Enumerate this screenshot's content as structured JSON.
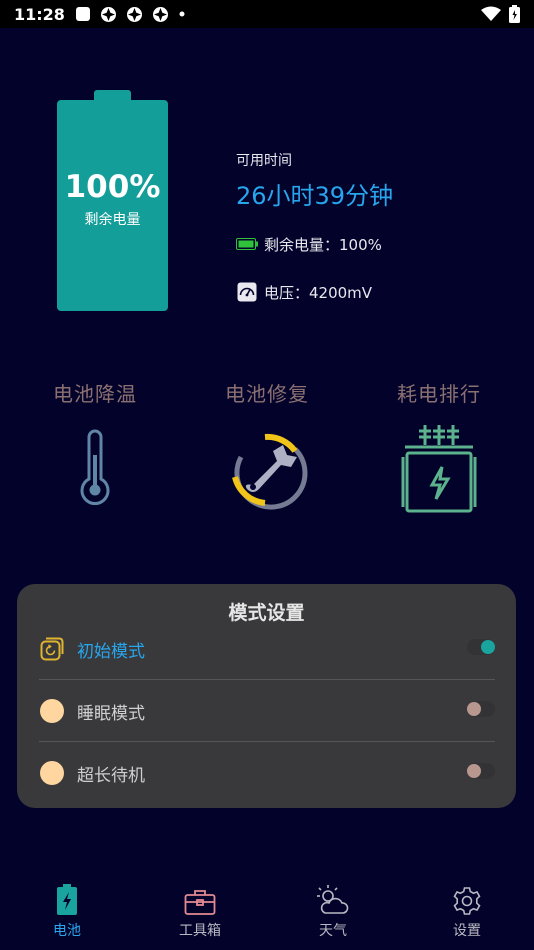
{
  "status_bar": {
    "time": "11:28",
    "icons": [
      "notification-square-icon",
      "app-icon",
      "app-icon",
      "app-icon",
      "dot-icon"
    ],
    "right_icons": [
      "wifi-icon",
      "battery-icon"
    ]
  },
  "battery": {
    "percent": "100%",
    "label": "剩余电量",
    "color": "#149e9a"
  },
  "info": {
    "available_label": "可用时间",
    "available_value": "26小时39分钟",
    "remaining_text": "剩余电量：100%",
    "voltage_text": "电压：4200mV"
  },
  "features": [
    {
      "title": "电池降温",
      "icon": "thermometer-icon"
    },
    {
      "title": "电池修复",
      "icon": "wrench-icon"
    },
    {
      "title": "耗电排行",
      "icon": "power-ranking-icon"
    }
  ],
  "modes": {
    "title": "模式设置",
    "items": [
      {
        "label": "初始模式",
        "icon": "restore-icon",
        "active": true
      },
      {
        "label": "睡眠模式",
        "icon": "dot-icon",
        "active": false
      },
      {
        "label": "超长待机",
        "icon": "dot-icon",
        "active": false
      }
    ]
  },
  "nav": {
    "items": [
      {
        "label": "电池",
        "icon": "battery-icon",
        "active": true
      },
      {
        "label": "工具箱",
        "icon": "toolbox-icon",
        "active": false
      },
      {
        "label": "天气",
        "icon": "weather-icon",
        "active": false
      },
      {
        "label": "设置",
        "icon": "gear-icon",
        "active": false
      }
    ]
  },
  "colors": {
    "background": "#03022a",
    "accent": "#27a6ee",
    "teal": "#149e9a",
    "panel": "#39393b"
  }
}
